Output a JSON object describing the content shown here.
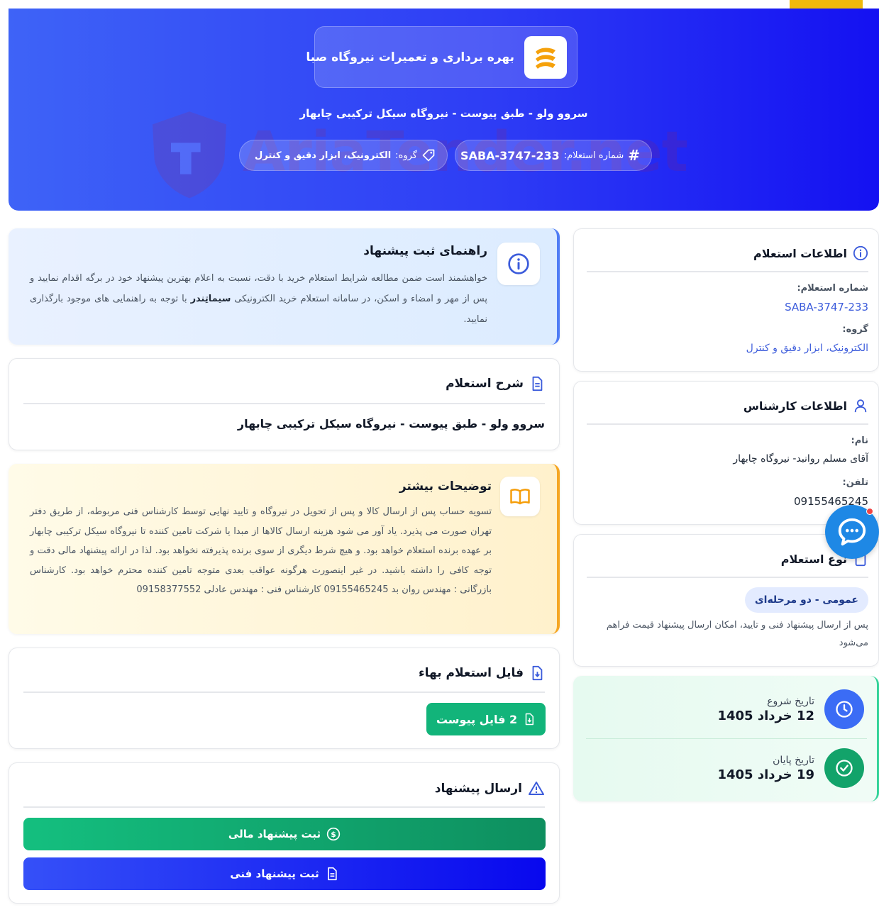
{
  "brand": {
    "name": "بهره برداری و تعمیرات نیروگاه صبا"
  },
  "hero": {
    "title": "سروو ولو - طبق پیوست - نیروگاه سیکل ترکیبی چابهار",
    "number_label": "شماره استعلام:",
    "number_value": "SABA-3747-233",
    "group_label": "گروه:",
    "group_value": "الکترونیک، ابزار دقیق و کنترل"
  },
  "watermark": {
    "text": "AriaTender.net"
  },
  "guide": {
    "title": "راهنمای ثبت پیشنهاد",
    "text_before": "خواهشمند است ضمن مطالعه شرایط استعلام خرید با دقت، نسبت به اعلام بهترین پیشنهاد خود در برگه اقدام نمایید و پس از مهر و امضاء و اسکن، در سامانه استعلام خرید الکترونیکی ",
    "text_bold": "سیماتِندر",
    "text_after": " با توجه به راهنمایی های موجود بارگذاری نمایید."
  },
  "description": {
    "title": "شرح استعلام",
    "text": "سروو ولو - طبق پیوست - نیروگاه سیکل ترکیبی چابهار"
  },
  "more": {
    "title": "توضیحات بیشتر",
    "text": "تسویه حساب پس از ارسال کالا و پس از تحویل در نیروگاه و تایید نهایی توسط کارشناس فنی مربوطه، از طریق دفتر تهران صورت می پذیرد. یاد آور می شود هزینه ارسال کالاها از مبدا یا شرکت تامین کننده تا نیروگاه سیکل ترکیبی چابهار بر عهده برنده استعلام خواهد بود. و هیچ شرط دیگری از سوی برنده پذیرفته نخواهد بود. لذا در ارائه پیشنهاد مالی دقت و توجه کافی را داشته باشید. در غیر اینصورت هرگونه عواقب بعدی متوجه تامین کننده محترم خواهد بود. کارشناس بازرگانی : مهندس روان بد 09155465245 کارشناس فنی : مهندس عادلی 09158377552"
  },
  "file": {
    "title": "فایل استعلام بهاء",
    "button": "2 فایل پیوست"
  },
  "send": {
    "title": "ارسال پیشنهاد",
    "financial_button": "ثبت پیشنهاد مالی",
    "technical_button": "ثبت پیشنهاد فنی"
  },
  "info": {
    "title": "اطلاعات استعلام",
    "number_label": "شماره استعلام:",
    "number_value": "SABA-3747-233",
    "group_label": "گروه:",
    "group_value": "الکترونیک، ابزار دقیق و کنترل"
  },
  "expert": {
    "title": "اطلاعات کارشناس",
    "name_label": "نام:",
    "name_value": "آقای مسلم روانبد- نیروگاه چابهار",
    "phone_label": "تلفن:",
    "phone_value": "09155465245"
  },
  "type": {
    "title": "نوع استعلام",
    "badge": "عمومی - دو مرحله‌ای",
    "text": "پس از ارسال پیشنهاد فنی و تایید، امکان ارسال پیشنهاد قیمت فراهم می‌شود"
  },
  "dates": {
    "start_label": "تاریخ شروع",
    "start_value": "12 خرداد 1405",
    "end_label": "تاریخ پایان",
    "end_value": "19 خرداد 1405"
  },
  "colors": {
    "primary": "#2e3df5",
    "accent": "#f0b90b",
    "success": "#12a36a",
    "link": "#3b5bdb"
  }
}
